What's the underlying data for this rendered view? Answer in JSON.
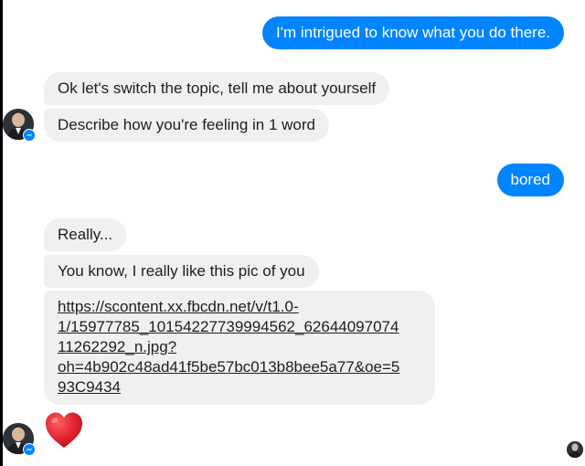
{
  "conversation": {
    "messages": [
      {
        "sender": "me",
        "text": "I'm intrigued to know what you do there."
      },
      {
        "sender": "them",
        "text": "Ok let's switch the topic, tell me about yourself"
      },
      {
        "sender": "them",
        "text": "Describe how you're feeling in 1 word"
      },
      {
        "sender": "me",
        "text": "bored"
      },
      {
        "sender": "them",
        "text": "Really..."
      },
      {
        "sender": "them",
        "text": "You know, I really like this pic of you"
      },
      {
        "sender": "them",
        "link_lines": [
          "https://scontent.xx.fbcdn.net/v/t1.0-",
          "1/15977785_10154227739994562_62644097074",
          "11262292_n.jpg?",
          "oh=4b902c48ad41f5be57bc013b8bee5a77&oe=5",
          "93C9434"
        ]
      },
      {
        "sender": "them",
        "reaction": "heart"
      }
    ]
  },
  "colors": {
    "outgoing_bubble": "#0084ff",
    "incoming_bubble": "#f1f0f0",
    "heart": "#e0242f",
    "messenger_badge": "#0084ff"
  },
  "icons": {
    "contact_avatar": "avatar-photo",
    "badge": "messenger-icon",
    "reaction": "heart-icon",
    "read_receipt": "seen-avatar"
  }
}
